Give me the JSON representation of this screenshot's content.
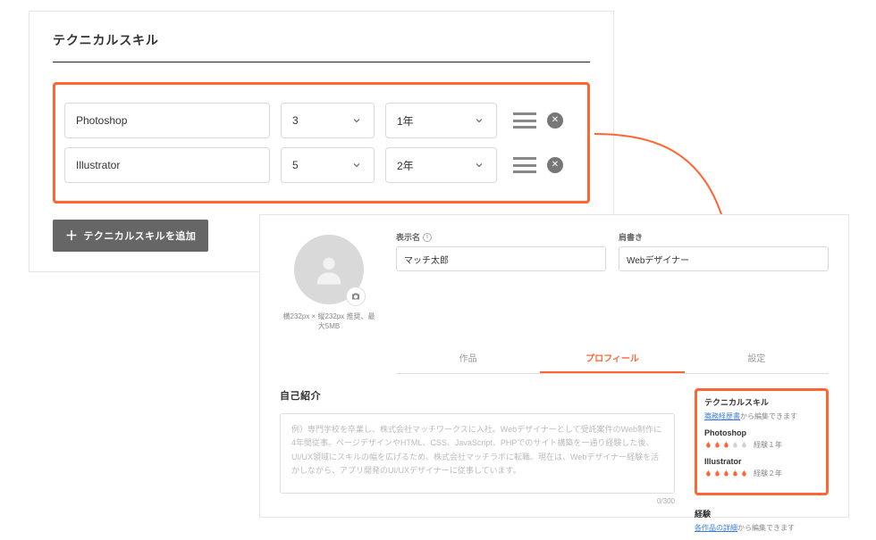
{
  "editor": {
    "title": "テクニカルスキル",
    "rows": [
      {
        "name": "Photoshop",
        "level": "3",
        "years": "1年"
      },
      {
        "name": "Illustrator",
        "level": "5",
        "years": "2年"
      }
    ],
    "add_btn": "テクニカルスキルを追加"
  },
  "preview": {
    "avatar_caption": "横232px × 縦232px 推奨、最大5MB",
    "display_name_label": "表示名",
    "display_name_value": "マッチ太郎",
    "title_label": "肩書き",
    "title_value": "Webデザイナー",
    "tabs": {
      "works": "作品",
      "profile": "プロフィール",
      "settings": "設定"
    },
    "bio": {
      "heading": "自己紹介",
      "placeholder": "例）専門学校を卒業し、株式会社マッチワークスに入社。Webデザイナーとして受託案件のWeb制作に4年間従事。ページデザインやHTML、CSS、JavaScript、PHPでのサイト構築を一通り経験した後、UI/UX領域にスキルの幅を広げるため、株式会社マッチラボに転職。現在は、Webデザイナー経験を活かしながら、アプリ開発のUI/UXデザイナーに従事しています。",
      "counter": "0/300"
    },
    "tech": {
      "heading": "テクニカルスキル",
      "sub_link": "職務経歴書",
      "sub_rest": "から編集できます",
      "skills": [
        {
          "name": "Photoshop",
          "years": "経験１年",
          "level": 3
        },
        {
          "name": "Illustrator",
          "years": "経験２年",
          "level": 5
        }
      ]
    },
    "exp": {
      "heading": "経験",
      "sub_link": "各作品の詳細",
      "sub_rest": "から編集できます"
    }
  }
}
